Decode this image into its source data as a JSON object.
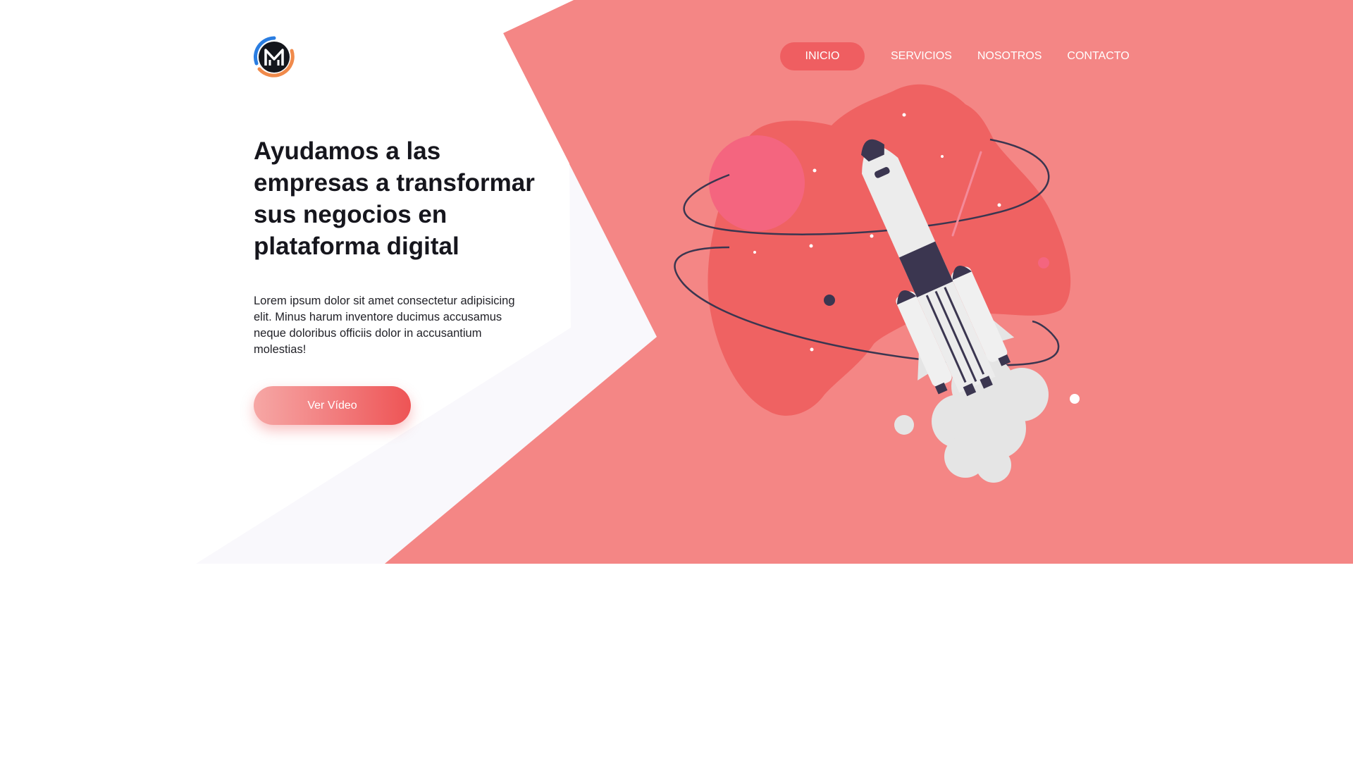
{
  "colors": {
    "hero_background": "#f48685",
    "accent": "#ef5e61",
    "shape_light": "#f9f8fc",
    "title_text": "#16161d",
    "rocket_dark": "#3b3650",
    "planet_pink": "#f4657f"
  },
  "header": {
    "logo_icon": "circular-m-logo-icon",
    "nav": [
      {
        "label": "INICIO",
        "active": true
      },
      {
        "label": "SERVICIOS",
        "active": false
      },
      {
        "label": "NOSOTROS",
        "active": false
      },
      {
        "label": "CONTACTO",
        "active": false
      }
    ]
  },
  "hero": {
    "title": "Ayudamos a las empresas a transformar sus negocios en plataforma digital",
    "description": "Lorem ipsum dolor sit amet consectetur adipisicing elit. Minus harum inventore ducimus accusamus neque doloribus officiis dolor in accusantium molestias!",
    "cta_label": "Ver Vídeo",
    "illustration_icon": "rocket-launch-illustration"
  }
}
